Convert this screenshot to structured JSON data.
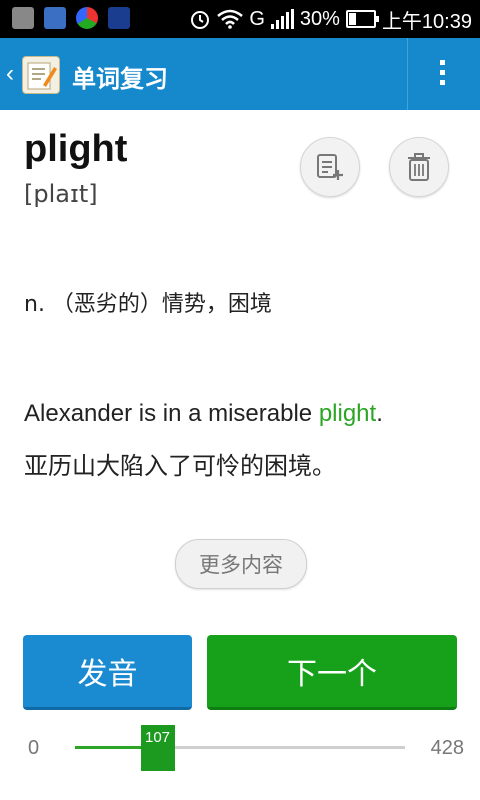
{
  "status_bar": {
    "network": "G",
    "battery_percent": "30%",
    "time": "上午10:39"
  },
  "header": {
    "title": "单词复习"
  },
  "word": {
    "text": "plight",
    "phonetic": "[plaɪt]",
    "definition": "n. （恶劣的）情势，困境",
    "example_en_before": "Alexander is in a miserable ",
    "example_en_highlight": "plight",
    "example_en_after": ".",
    "example_zh": "亚历山大陷入了可怜的困境。"
  },
  "buttons": {
    "more": "更多内容",
    "pronounce": "发音",
    "next": "下一个"
  },
  "progress": {
    "min": "0",
    "max": "428",
    "current": "107",
    "fraction": 0.25
  },
  "colors": {
    "action_bar": "#1689cc",
    "highlight": "#2ca524",
    "pronounce_button": "#1a8ad1",
    "next_button": "#17a11b"
  }
}
